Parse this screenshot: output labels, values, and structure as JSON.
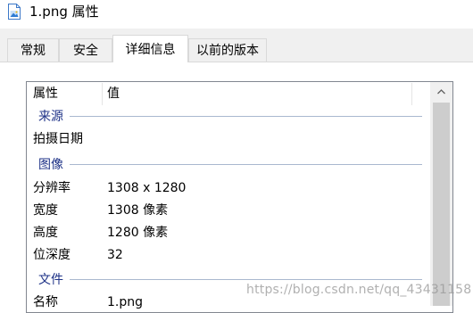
{
  "window": {
    "title": "1.png 属性",
    "icon": "image-file-icon"
  },
  "tabs": [
    {
      "label": "常规",
      "active": false
    },
    {
      "label": "安全",
      "active": false
    },
    {
      "label": "详细信息",
      "active": true
    },
    {
      "label": "以前的版本",
      "active": false
    }
  ],
  "details": {
    "columns": {
      "property": "属性",
      "value": "值"
    },
    "groups": {
      "source": {
        "label": "来源",
        "rows": [
          {
            "name": "拍摄日期",
            "value": ""
          }
        ]
      },
      "image": {
        "label": "图像",
        "rows": [
          {
            "name": "分辨率",
            "value": "1308 x 1280"
          },
          {
            "name": "宽度",
            "value": "1308 像素"
          },
          {
            "name": "高度",
            "value": "1280 像素"
          },
          {
            "name": "位深度",
            "value": "32"
          }
        ]
      },
      "file": {
        "label": "文件",
        "rows": [
          {
            "name": "名称",
            "value": "1.png"
          }
        ]
      }
    }
  },
  "scrollbar": {
    "up_icon": "chevron-up-icon"
  },
  "watermark": "https://blog.csdn.net/qq_43431158",
  "colors": {
    "group_label": "#1e3287",
    "group_line": "#a9b8cf",
    "tab_strip": "#f0f0f0"
  }
}
